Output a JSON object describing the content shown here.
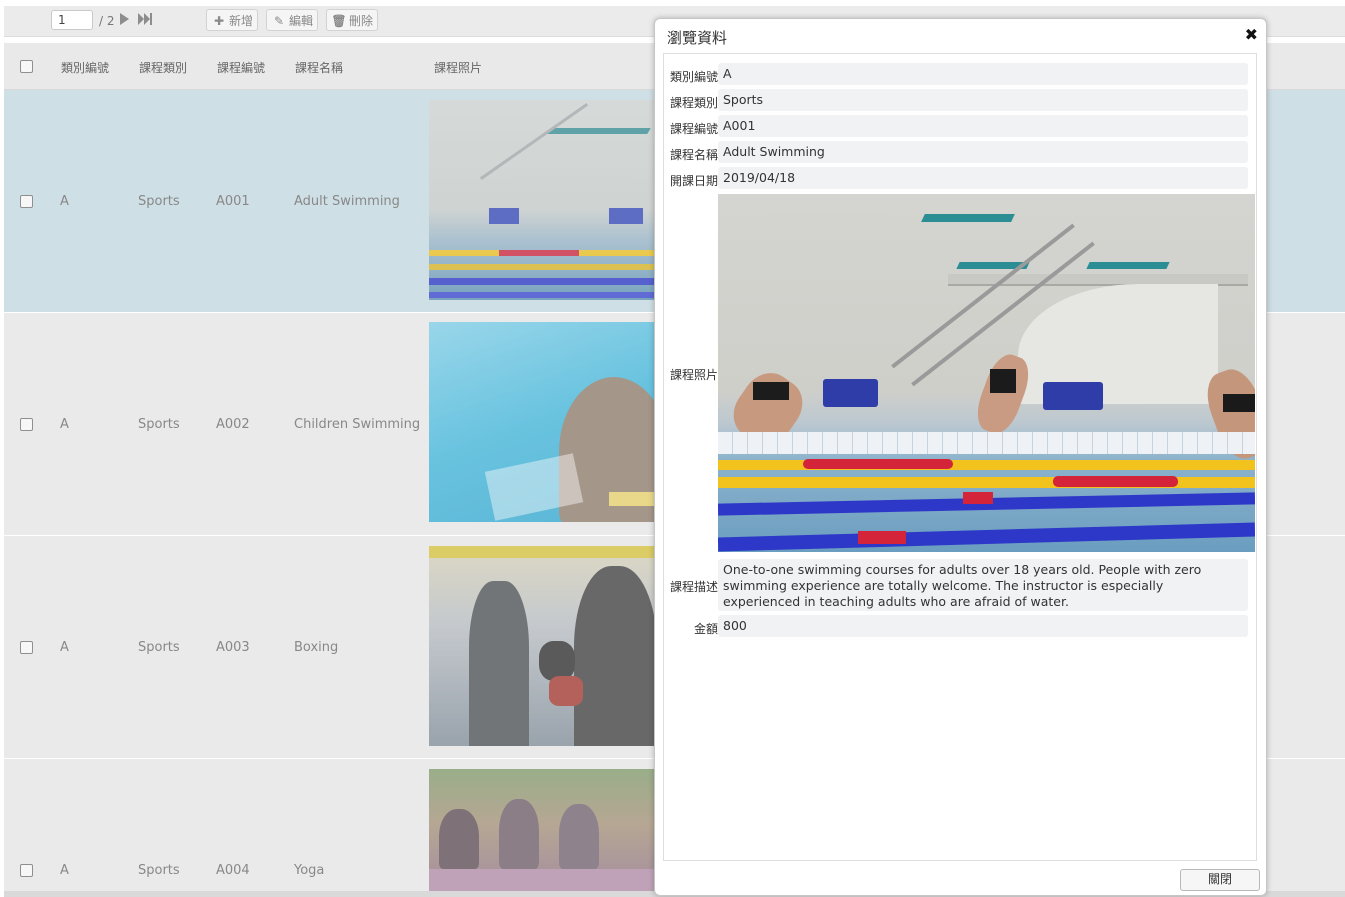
{
  "toolbar": {
    "page_value": "1",
    "page_total": "/ 2",
    "add_label": "新增",
    "edit_label": "編輯",
    "delete_label": "刪除"
  },
  "grid": {
    "columns": [
      "類別編號",
      "課程類別",
      "課程編號",
      "課程名稱",
      "課程照片"
    ],
    "rows": [
      {
        "category_id": "A",
        "category": "Sports",
        "course_id": "A001",
        "name": "Adult Swimming",
        "photo_icon": "swimming-pool-photo"
      },
      {
        "category_id": "A",
        "category": "Sports",
        "course_id": "A002",
        "name": "Children Swimming",
        "photo_icon": "child-in-pool-photo"
      },
      {
        "category_id": "A",
        "category": "Sports",
        "course_id": "A003",
        "name": "Boxing",
        "photo_icon": "boxing-gym-photo"
      },
      {
        "category_id": "A",
        "category": "Sports",
        "course_id": "A004",
        "name": "Yoga",
        "photo_icon": "yoga-class-photo"
      }
    ]
  },
  "modal": {
    "title": "瀏覽資料",
    "close_icon": "close-icon",
    "fields": {
      "category_id_label": "類別編號",
      "category_id": "A",
      "category_label": "課程類別",
      "category": "Sports",
      "course_id_label": "課程編號",
      "course_id": "A001",
      "name_label": "課程名稱",
      "name": "Adult Swimming",
      "date_label": "開課日期",
      "date": "2019/04/18",
      "photo_label": "課程照片",
      "description_label": "課程描述",
      "description": "One-to-one swimming courses for adults over 18 years old. People with zero swimming experience are totally welcome. The instructor is especially experienced in teaching adults who are afraid of water.",
      "price_label": "金額",
      "price": "800"
    },
    "close_button_label": "關閉"
  },
  "colors": {
    "selected_row": "#cfdfe6",
    "row_bg": "#eaeaea",
    "lane_red": "#d3243a",
    "lane_yellow": "#f2c31c",
    "lane_blue": "#2e38c8",
    "pool_water": "#6fa8c9"
  }
}
